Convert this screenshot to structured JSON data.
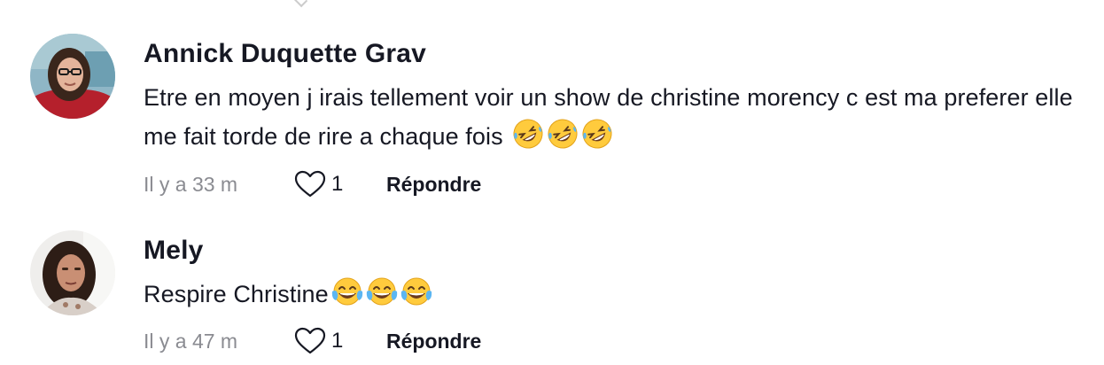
{
  "comments": [
    {
      "username": "Annick Duquette Grav",
      "text": "Etre en moyen j irais tellement voir un show de christine morency c est ma preferer elle me fait torde de rire a chaque fois",
      "emojis": [
        "rolling-on-floor-laughing",
        "rolling-on-floor-laughing",
        "rolling-on-floor-laughing"
      ],
      "time": "Il y a 33 m",
      "likes": "1",
      "reply_label": "Répondre"
    },
    {
      "username": "Mely",
      "text": "Respire Christine",
      "emojis": [
        "tears-of-joy",
        "tears-of-joy",
        "tears-of-joy"
      ],
      "time": "Il y a 47 m",
      "likes": "1",
      "reply_label": "Répondre"
    }
  ],
  "icons": {
    "like": "heart-outline-icon"
  },
  "colors": {
    "text": "#161823",
    "muted": "#8a8b91"
  }
}
